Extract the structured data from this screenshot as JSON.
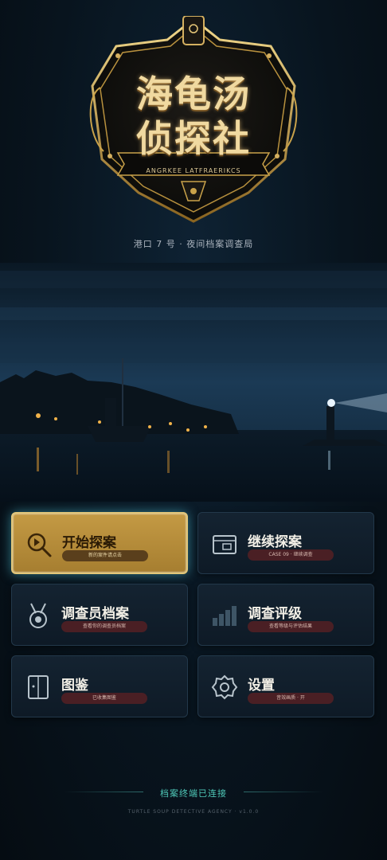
{
  "emblem": {
    "title_line1": "海龟汤",
    "title_line2": "侦探社",
    "subtitle": "ANGRKEE LATFRAERIKCS"
  },
  "tagline": "港口 7 号 · 夜间档案调查局",
  "menu": {
    "start": {
      "label": "开始探案",
      "sub": "新的案件请点击"
    },
    "continue": {
      "label": "继续探案",
      "sub": "CASE 09 · 继续调查"
    },
    "profile": {
      "label": "调查员档案",
      "sub": "查看你的调查员档案"
    },
    "rating": {
      "label": "调查评级",
      "sub": "查看等级与评估结果"
    },
    "gallery": {
      "label": "图鉴",
      "sub": "已收集图鉴"
    },
    "settings": {
      "label": "设置",
      "sub": "音效画质 · 开"
    }
  },
  "footer": {
    "main": "档案终端已连接",
    "sub": "TURTLE SOUP DETECTIVE AGENCY · v1.0.0"
  },
  "colors": {
    "primary_card": "#c49a44",
    "card_bg": "#142331",
    "pill_red": "#4a1f24",
    "accent_teal": "#4fc8b8",
    "gold": "#f0d9a0"
  }
}
